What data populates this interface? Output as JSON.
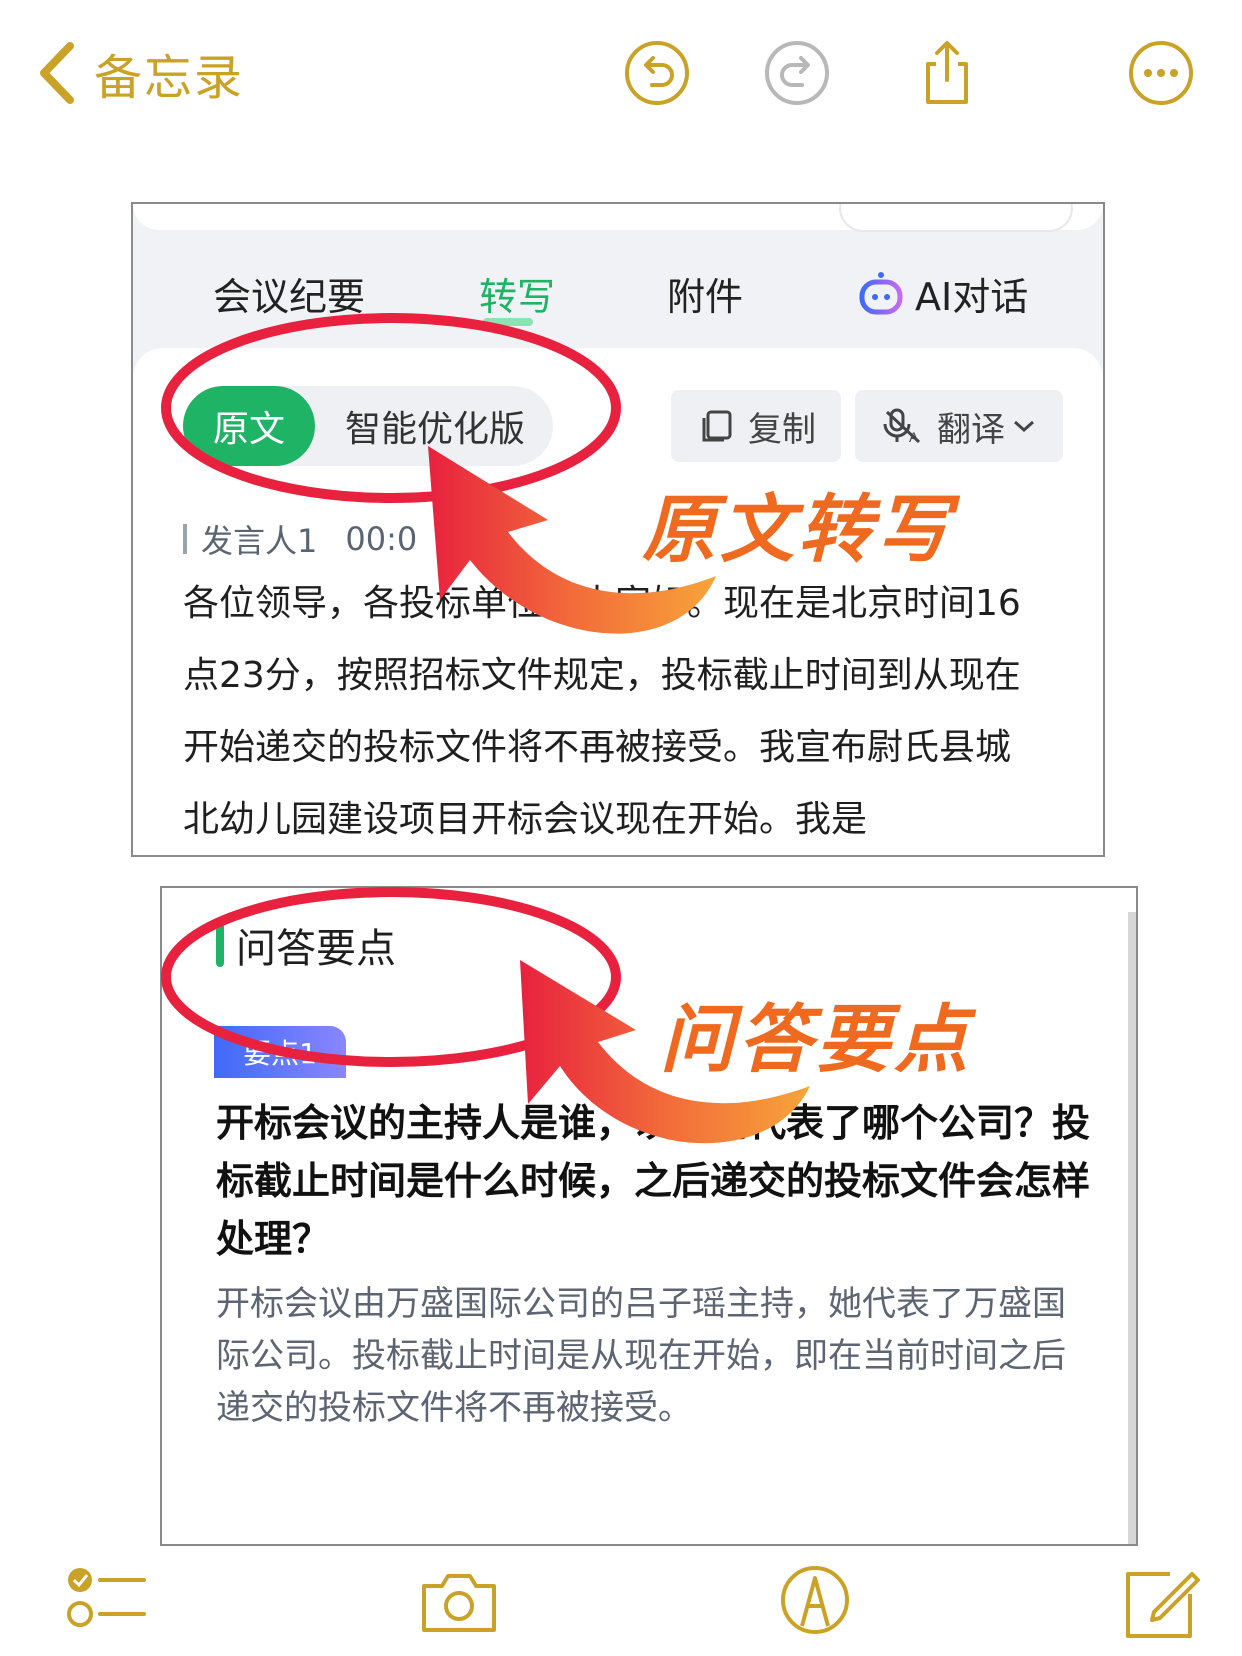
{
  "nav": {
    "back_label": "备忘录"
  },
  "colors": {
    "accent_gold": "#c9a227",
    "green": "#1fb365",
    "annotation_red": "#e8213f",
    "annotation_orange": "#ef6a1f"
  },
  "panel1": {
    "tabs": [
      "会议纪要",
      "转写",
      "附件",
      "AI对话"
    ],
    "active_tab": "转写",
    "segment": {
      "original": "原文",
      "optimized": "智能优化版"
    },
    "copy_label": "复制",
    "translate_label": "翻译",
    "speaker": {
      "name": "发言人1",
      "time": "00:0"
    },
    "transcript": "各位领导，各投标单位，大家好。现在是北京时间16点23分，按照招标文件规定，投标截止时间到从现在开始递交的投标文件将不再被接受。我宣布尉氏县城北幼儿园建设项目开标会议现在开始。我是"
  },
  "panel2": {
    "section_title": "问答要点",
    "badge": "要点1",
    "question": "开标会议的主持人是谁，以及他代表了哪个公司？投标截止时间是什么时候，之后递交的投标文件会怎样处理？",
    "answer": "开标会议由万盛国际公司的吕子瑶主持，她代表了万盛国际公司。投标截止时间是从现在开始，即在当前时间之后递交的投标文件将不再被接受。"
  },
  "annotations": {
    "label1": "原文转写",
    "label2": "问答要点"
  },
  "icons": {
    "nav": [
      "chevron-left-icon",
      "undo-icon",
      "redo-icon",
      "share-icon",
      "more-icon"
    ],
    "bottom": [
      "checklist-icon",
      "camera-icon",
      "markup-icon",
      "compose-icon"
    ]
  }
}
